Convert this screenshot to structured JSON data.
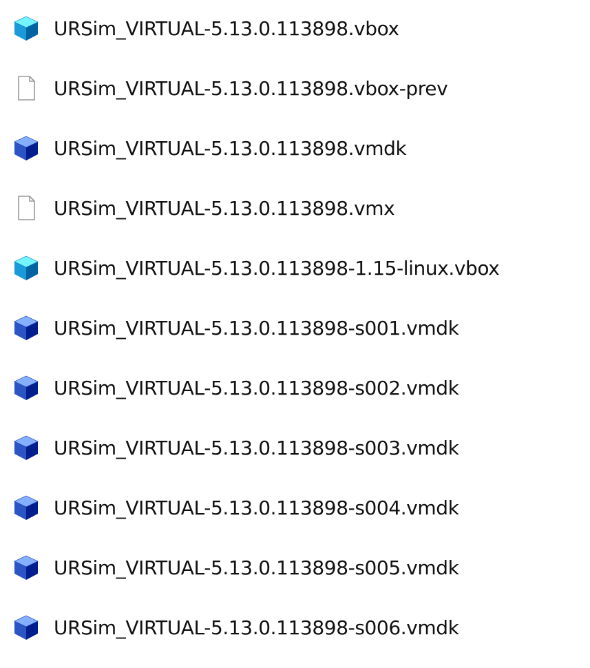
{
  "files": [
    {
      "name": "URSim_VIRTUAL-5.13.0.113898.vbox",
      "icon": "virtualbox-cube-icon",
      "color": "#1a9ad9"
    },
    {
      "name": "URSim_VIRTUAL-5.13.0.113898.vbox-prev",
      "icon": "blank-file-icon",
      "color": "#9a9a9a"
    },
    {
      "name": "URSim_VIRTUAL-5.13.0.113898.vmdk",
      "icon": "virtual-disk-cube-icon",
      "color": "#2b55c4"
    },
    {
      "name": "URSim_VIRTUAL-5.13.0.113898.vmx",
      "icon": "blank-file-icon",
      "color": "#9a9a9a"
    },
    {
      "name": "URSim_VIRTUAL-5.13.0.113898-1.15-linux.vbox",
      "icon": "virtualbox-cube-icon",
      "color": "#1a9ad9"
    },
    {
      "name": "URSim_VIRTUAL-5.13.0.113898-s001.vmdk",
      "icon": "virtual-disk-cube-icon",
      "color": "#2b55c4"
    },
    {
      "name": "URSim_VIRTUAL-5.13.0.113898-s002.vmdk",
      "icon": "virtual-disk-cube-icon",
      "color": "#2b55c4"
    },
    {
      "name": "URSim_VIRTUAL-5.13.0.113898-s003.vmdk",
      "icon": "virtual-disk-cube-icon",
      "color": "#2b55c4"
    },
    {
      "name": "URSim_VIRTUAL-5.13.0.113898-s004.vmdk",
      "icon": "virtual-disk-cube-icon",
      "color": "#2b55c4"
    },
    {
      "name": "URSim_VIRTUAL-5.13.0.113898-s005.vmdk",
      "icon": "virtual-disk-cube-icon",
      "color": "#2b55c4"
    },
    {
      "name": "URSim_VIRTUAL-5.13.0.113898-s006.vmdk",
      "icon": "virtual-disk-cube-icon",
      "color": "#2b55c4"
    }
  ]
}
